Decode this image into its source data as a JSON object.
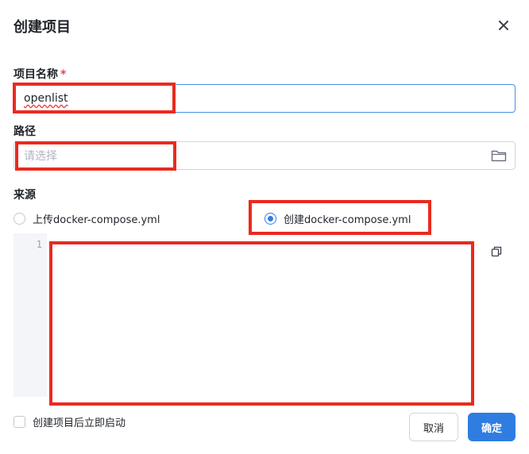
{
  "dialog": {
    "title": "创建项目",
    "close_icon": "close-icon"
  },
  "form": {
    "project_name": {
      "label": "项目名称",
      "required_mark": "*",
      "value": "openlist"
    },
    "path": {
      "label": "路径",
      "placeholder": "请选择",
      "icon": "folder-icon"
    },
    "source": {
      "label": "来源",
      "options": [
        {
          "label": "上传docker-compose.yml",
          "selected": false
        },
        {
          "label": "创建docker-compose.yml",
          "selected": true
        }
      ]
    },
    "editor": {
      "line_numbers": [
        "1"
      ],
      "copy_icon": "copy-icon"
    }
  },
  "footer": {
    "start_after_create_label": "创建项目后立即启动",
    "start_after_create_checked": false,
    "cancel_label": "取消",
    "confirm_label": "确定"
  },
  "colors": {
    "accent": "#2f7de1",
    "annotation_red": "#ea2a1f",
    "required_red": "#e5484d"
  }
}
